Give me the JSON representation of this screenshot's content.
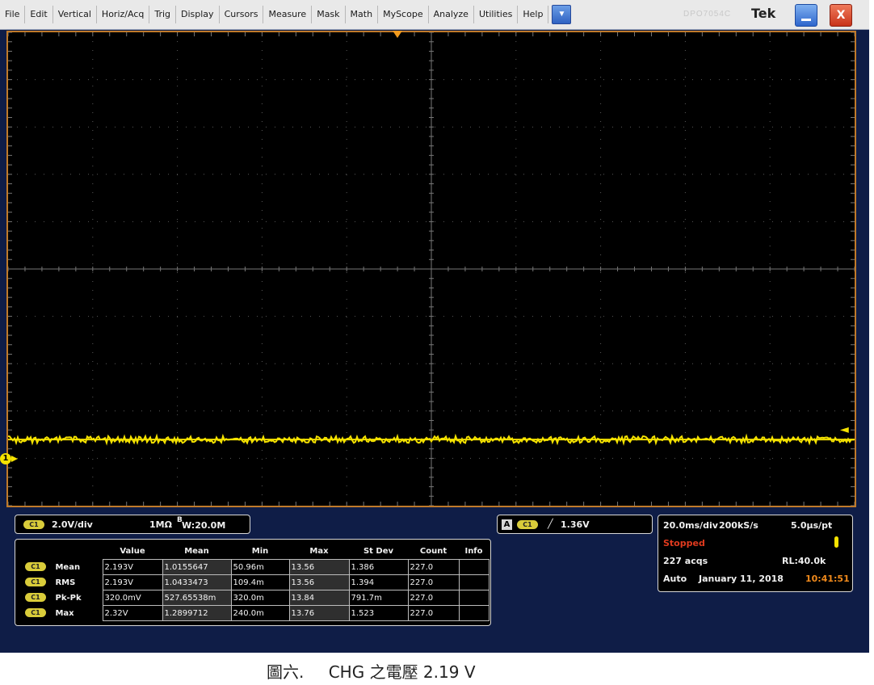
{
  "menubar": {
    "items": [
      "File",
      "Edit",
      "Vertical",
      "Horiz/Acq",
      "Trig",
      "Display",
      "Cursors",
      "Measure",
      "Mask",
      "Math",
      "MyScope",
      "Analyze",
      "Utilities",
      "Help"
    ],
    "dropdown_glyph": "▼",
    "ghost_text": "DPO7054C",
    "brand": "Tek",
    "close_glyph": "X"
  },
  "display": {
    "ch1_marker_label": "1",
    "trace_color": "#f5e200",
    "grid_color": "#5a5a5a"
  },
  "chart_data": {
    "type": "line",
    "title": "",
    "xlabel": "",
    "ylabel": "",
    "x_divisions": 10,
    "y_divisions": 10,
    "volts_per_div": 2.0,
    "time_per_div_ms": 20.0,
    "ylim_volts": [
      -0.6,
      19.4
    ],
    "xlim_ms": [
      -100,
      100
    ],
    "series": [
      {
        "name": "C1",
        "mean_volts": 2.193,
        "pkpk_volts": 0.32
      }
    ],
    "grid": true,
    "trigger_level_volts": 1.36
  },
  "channel_panel": {
    "badge": "C1",
    "scale": "2.0V/div",
    "impedance": "1MΩ",
    "bw_label": "B",
    "bw_value": "W:20.0M"
  },
  "trigger_panel": {
    "mode_badge": "A",
    "source_badge": "C1",
    "slope_glyph": "╱",
    "level": "1.36V"
  },
  "horizontal_panel": {
    "timebase": "20.0ms/div",
    "sample_rate": "200kS/s",
    "resolution": "5.0µs/pt",
    "status": "Stopped",
    "acqs": "227 acqs",
    "record_length": "RL:40.0k",
    "mode": "Auto",
    "date": "January 11, 2018",
    "time": "10:41:51"
  },
  "measurements": {
    "headers": [
      "Value",
      "Mean",
      "Min",
      "Max",
      "St Dev",
      "Count",
      "Info"
    ],
    "rows": [
      {
        "badge": "C1",
        "name": "Mean",
        "value": "2.193V",
        "mean": "1.0155647",
        "min": "50.96m",
        "max": "13.56",
        "stdev": "1.386",
        "count": "227.0",
        "info": ""
      },
      {
        "badge": "C1",
        "name": "RMS",
        "value": "2.193V",
        "mean": "1.0433473",
        "min": "109.4m",
        "max": "13.56",
        "stdev": "1.394",
        "count": "227.0",
        "info": ""
      },
      {
        "badge": "C1",
        "name": "Pk-Pk",
        "value": "320.0mV",
        "mean": "527.65538m",
        "min": "320.0m",
        "max": "13.84",
        "stdev": "791.7m",
        "count": "227.0",
        "info": ""
      },
      {
        "badge": "C1",
        "name": "Max",
        "value": "2.32V",
        "mean": "1.2899712",
        "min": "240.0m",
        "max": "13.76",
        "stdev": "1.523",
        "count": "227.0",
        "info": ""
      }
    ]
  },
  "caption": {
    "label": "圖六.",
    "text": "CHG 之電壓 2.19 V"
  }
}
